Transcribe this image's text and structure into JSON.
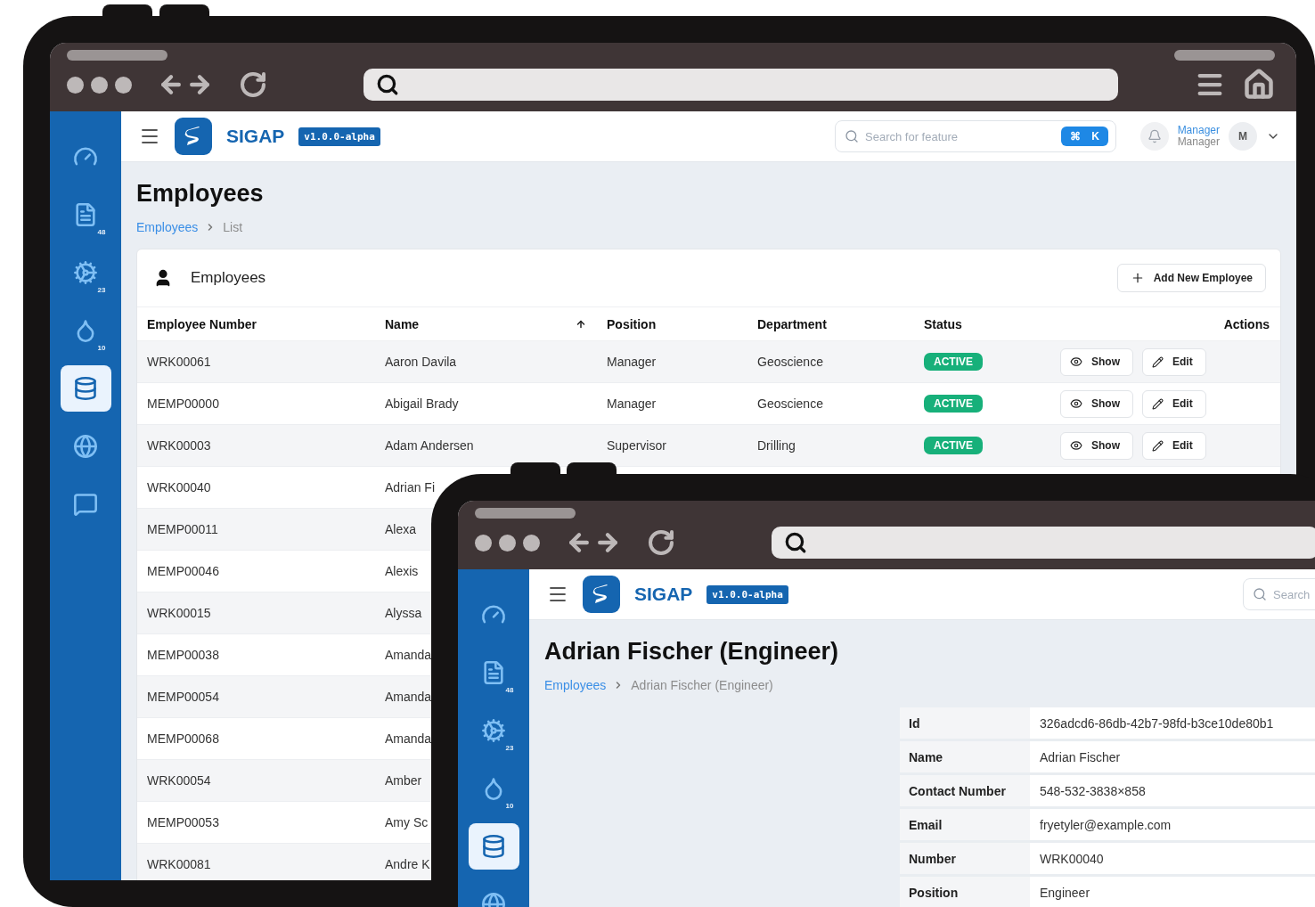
{
  "back_window": {
    "chrome": {
      "toolbar_right": true
    },
    "sidebar": {
      "items": [
        {
          "selected": false
        },
        {
          "badge": "48",
          "selected": false
        },
        {
          "badge": "23",
          "selected": false
        },
        {
          "badge": "10",
          "selected": false
        },
        {
          "selected": true
        },
        {
          "selected": false
        },
        {
          "selected": false
        }
      ]
    },
    "header": {
      "brand": "SIGAP",
      "version": "v1.0.0-alpha",
      "search": {
        "placeholder": "Search for feature",
        "shortcut": [
          "⌘",
          "K"
        ]
      },
      "user": {
        "name": "Manager",
        "role": "Manager",
        "initial": "M"
      }
    },
    "title": "Employees",
    "breadcrumb": [
      {
        "label": "Employees",
        "kind": "link"
      },
      {
        "label": "List",
        "kind": "current"
      }
    ],
    "card": {
      "title": "Employees",
      "add_button": "Add New Employee",
      "columns": [
        {
          "label": "Employee Number"
        },
        {
          "label": "Name",
          "sorted": true
        },
        {
          "label": "Position"
        },
        {
          "label": "Department"
        },
        {
          "label": "Status"
        },
        {
          "label": "Actions"
        }
      ],
      "rows": [
        {
          "number": "WRK00061",
          "name": "Aaron Davila",
          "position": "Manager",
          "department": "Geoscience",
          "status": "ACTIVE",
          "actions": [
            "Show",
            "Edit"
          ]
        },
        {
          "number": "MEMP00000",
          "name": "Abigail Brady",
          "position": "Manager",
          "department": "Geoscience",
          "status": "ACTIVE",
          "actions": [
            "Show",
            "Edit"
          ]
        },
        {
          "number": "WRK00003",
          "name": "Adam Andersen",
          "position": "Supervisor",
          "department": "Drilling",
          "status": "ACTIVE",
          "actions": [
            "Show",
            "Edit"
          ]
        },
        {
          "number": "WRK00040",
          "name": "Adrian Fi"
        },
        {
          "number": "MEMP00011",
          "name": "Alexa"
        },
        {
          "number": "MEMP00046",
          "name": "Alexis"
        },
        {
          "number": "WRK00015",
          "name": "Alyssa"
        },
        {
          "number": "MEMP00038",
          "name": "Amanda"
        },
        {
          "number": "MEMP00054",
          "name": "Amanda"
        },
        {
          "number": "MEMP00068",
          "name": "Amanda"
        },
        {
          "number": "WRK00054",
          "name": "Amber"
        },
        {
          "number": "MEMP00053",
          "name": "Amy Sc"
        },
        {
          "number": "WRK00081",
          "name": "Andre K"
        }
      ]
    }
  },
  "front_window": {
    "chrome": {
      "toolbar_right": false
    },
    "sidebar": {
      "items": [
        {
          "selected": false
        },
        {
          "badge": "48",
          "selected": false
        },
        {
          "badge": "23",
          "selected": false
        },
        {
          "badge": "10",
          "selected": false
        },
        {
          "selected": true
        },
        {
          "selected": false
        }
      ]
    },
    "header": {
      "brand": "SIGAP",
      "version": "v1.0.0-alpha",
      "search": {
        "placeholder": "Search"
      }
    },
    "title": "Adrian Fischer (Engineer)",
    "breadcrumb": [
      {
        "label": "Employees",
        "kind": "link"
      },
      {
        "label": "Adrian Fischer (Engineer)",
        "kind": "current"
      }
    ],
    "details": [
      {
        "label": "Id",
        "value": "326adcd6-86db-42b7-98fd-b3ce10de80b1"
      },
      {
        "label": "Name",
        "value": "Adrian Fischer"
      },
      {
        "label": "Contact Number",
        "value": "548-532-3838×858"
      },
      {
        "label": "Email",
        "value": "fryetyler@example.com"
      },
      {
        "label": "Number",
        "value": "WRK00040"
      },
      {
        "label": "Position",
        "value": "Engineer"
      }
    ]
  }
}
